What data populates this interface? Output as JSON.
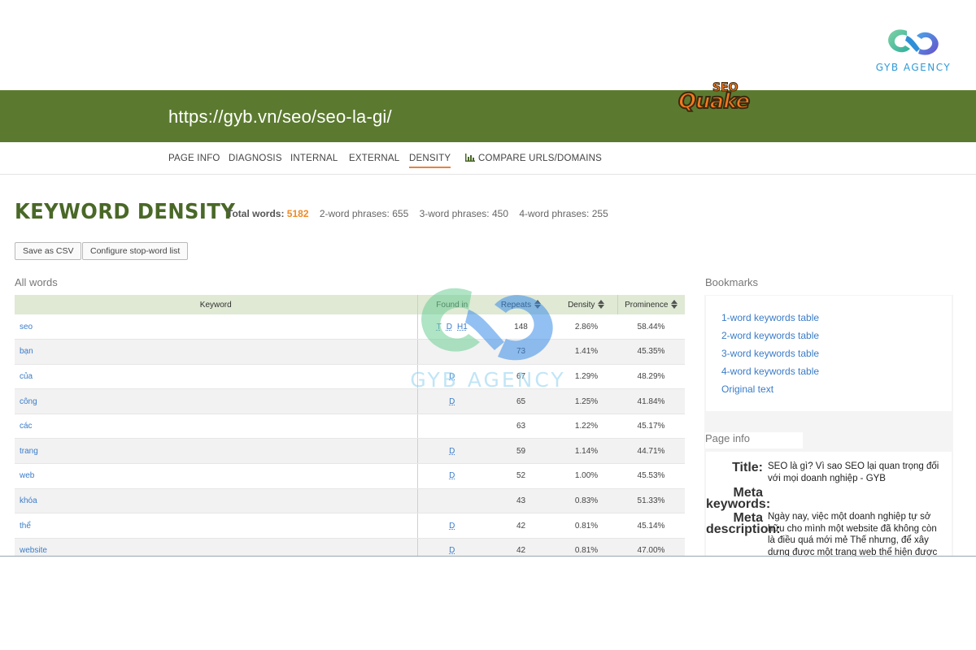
{
  "brand": {
    "name": "GYB AGENCY"
  },
  "header": {
    "url": "https://gyb.vn/seo/seo-la-gi/",
    "logo_seo": "SEO",
    "logo_quake": "Quake"
  },
  "nav": {
    "tabs": [
      {
        "label": "PAGE INFO"
      },
      {
        "label": "DIAGNOSIS"
      },
      {
        "label": "INTERNAL"
      },
      {
        "label": "EXTERNAL"
      },
      {
        "label": "DENSITY",
        "active": true
      },
      {
        "label": "COMPARE URLS/DOMAINS",
        "icon": "bar-chart-icon"
      }
    ]
  },
  "main": {
    "title": "KEYWORD DENSITY",
    "stats": {
      "total_words_label": "Total words:",
      "total_words": "5182",
      "two_word": "2-word phrases: 655",
      "three_word": "3-word phrases: 450",
      "four_word": "4-word phrases: 255"
    },
    "buttons": {
      "save_csv": "Save as CSV",
      "configure": "Configure stop-word list"
    },
    "section_label": "All words",
    "table": {
      "headers": {
        "keyword": "Keyword",
        "found_in": "Found in",
        "repeats": "Repeats",
        "density": "Density",
        "prominence": "Prominence"
      },
      "rows": [
        {
          "keyword": "seo",
          "found": [
            "T",
            "D",
            "H1"
          ],
          "repeats": "148",
          "density": "2.86%",
          "prominence": "58.44%"
        },
        {
          "keyword": "bạn",
          "found": [],
          "repeats": "73",
          "density": "1.41%",
          "prominence": "45.35%"
        },
        {
          "keyword": "của",
          "found": [
            "D"
          ],
          "repeats": "67",
          "density": "1.29%",
          "prominence": "48.29%"
        },
        {
          "keyword": "công",
          "found": [
            "D"
          ],
          "repeats": "65",
          "density": "1.25%",
          "prominence": "41.84%"
        },
        {
          "keyword": "các",
          "found": [],
          "repeats": "63",
          "density": "1.22%",
          "prominence": "45.17%"
        },
        {
          "keyword": "trang",
          "found": [
            "D"
          ],
          "repeats": "59",
          "density": "1.14%",
          "prominence": "44.71%"
        },
        {
          "keyword": "web",
          "found": [
            "D"
          ],
          "repeats": "52",
          "density": "1.00%",
          "prominence": "45.53%"
        },
        {
          "keyword": "khóa",
          "found": [],
          "repeats": "43",
          "density": "0.83%",
          "prominence": "51.33%"
        },
        {
          "keyword": "thể",
          "found": [
            "D"
          ],
          "repeats": "42",
          "density": "0.81%",
          "prominence": "45.14%"
        },
        {
          "keyword": "website",
          "found": [
            "D"
          ],
          "repeats": "42",
          "density": "0.81%",
          "prominence": "47.00%"
        }
      ]
    }
  },
  "sidebar": {
    "bookmarks_label": "Bookmarks",
    "bookmarks": [
      "1-word keywords table",
      "2-word keywords table",
      "3-word keywords table",
      "4-word keywords table",
      "Original text"
    ],
    "page_info_label": "Page info",
    "page_info": {
      "title_label": "Title:",
      "title_value": "SEO là gì? Vì sao SEO lại quan trọng đối với mọi doanh nghiệp - GYB",
      "meta_kw_label_1": "Meta",
      "meta_kw_label_2": "keywords:",
      "meta_desc_label_1": "Meta",
      "meta_desc_label_2": "description:",
      "meta_desc_value": "Ngày nay, việc một doanh nghiệp tự sở hữu cho mình một website đã không còn là điều quá mới mẻ Thế nhưng, để xây dựng được một trang web thể hiện được"
    }
  },
  "colors": {
    "header_green": "#5b7a2f",
    "accent_orange": "#f08a24",
    "link_blue": "#3a7cc8"
  }
}
